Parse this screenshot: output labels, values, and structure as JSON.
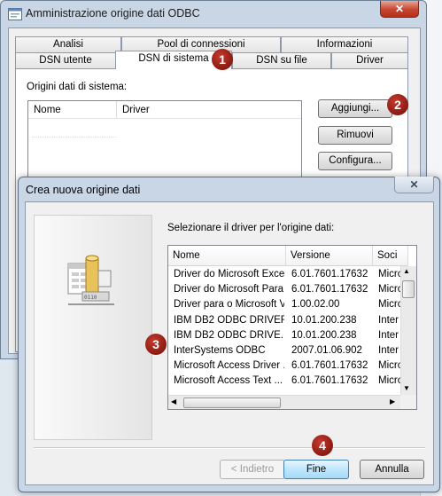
{
  "main_window": {
    "title": "Amministrazione origine dati ODBC",
    "close": "✕",
    "tabs_back": [
      "Analisi",
      "Pool di connessioni",
      "Informazioni"
    ],
    "tabs_front": [
      "DSN utente",
      "DSN di sistema",
      "DSN su file",
      "Driver"
    ],
    "section_label": "Origini dati di sistema:",
    "columns": [
      "Nome",
      "Driver"
    ],
    "buttons": {
      "add": "Aggiungi...",
      "remove": "Rimuovi",
      "configure": "Configura..."
    }
  },
  "dialog": {
    "title": "Crea nuova origine dati",
    "close": "✕",
    "prompt": "Selezionare il driver per l'origine dati:",
    "columns": [
      "Nome",
      "Versione",
      "Soci"
    ],
    "rows": [
      {
        "name": "Driver do Microsoft Exce...",
        "version": "6.01.7601.17632",
        "company": "Micro"
      },
      {
        "name": "Driver do Microsoft Para...",
        "version": "6.01.7601.17632",
        "company": "Micro"
      },
      {
        "name": "Driver para o Microsoft V...",
        "version": "1.00.02.00",
        "company": "Micro"
      },
      {
        "name": "IBM DB2 ODBC DRIVER",
        "version": "10.01.200.238",
        "company": "Inter"
      },
      {
        "name": "IBM DB2 ODBC DRIVE...",
        "version": "10.01.200.238",
        "company": "Inter"
      },
      {
        "name": "InterSystems ODBC",
        "version": "2007.01.06.902",
        "company": "Inter"
      },
      {
        "name": "Microsoft Access Driver ...",
        "version": "6.01.7601.17632",
        "company": "Micro"
      },
      {
        "name": "Microsoft Access Text ...",
        "version": "6.01.7601.17632",
        "company": "Micro"
      }
    ],
    "buttons": {
      "back": "< Indietro",
      "finish": "Fine",
      "cancel": "Annulla"
    }
  },
  "markers": [
    "1",
    "2",
    "3",
    "4"
  ],
  "colors": {
    "marker": "#8b1a12",
    "title_bar": "#c8d6e6"
  },
  "icons": [
    "database-setup-icon",
    "window-app-icon"
  ]
}
